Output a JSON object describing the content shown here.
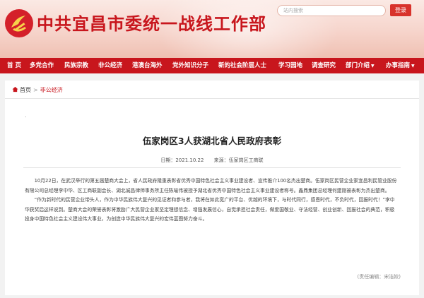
{
  "header": {
    "site_title": "中共宜昌市委统一战线工作部",
    "search_placeholder": "站内搜索",
    "login_label": "登录"
  },
  "colors": {
    "brand_red": "#c8161d",
    "login_red": "#d8322b"
  },
  "nav": {
    "items": [
      {
        "label": "首 页",
        "caret": ""
      },
      {
        "label": "多党合作",
        "caret": ""
      },
      {
        "label": "民族宗教",
        "caret": ""
      },
      {
        "label": "非公经济",
        "caret": ""
      },
      {
        "label": "港澳台海外",
        "caret": ""
      },
      {
        "label": "党外知识分子",
        "caret": ""
      },
      {
        "label": "新的社会阶层人士",
        "caret": ""
      },
      {
        "label": "学习园地",
        "caret": ""
      },
      {
        "label": "调查研究",
        "caret": ""
      },
      {
        "label": "部门介绍",
        "caret": "▼"
      },
      {
        "label": "办事指南",
        "caret": "▼"
      }
    ]
  },
  "breadcrumb": {
    "home": "首页",
    "sep": ">",
    "category": "非公经济"
  },
  "article": {
    "dot": ".",
    "title": "伍家岗区3人获湖北省人民政府表彰",
    "date": "日期：2021.10.22",
    "source": "来源：伍家岗区工商联",
    "paragraphs": [
      "10月22日，在武汉举行的第五届楚商大会上，省人民政府隆重表彰省优秀中国特色社会主义事业建设者、宣传推介100名杰出楚商。伍家岗区民营企业家宜昌利民管业股份有限公司总经理李中华、区工商联副会长、湖北诚昌律师事务所主任陈喻伟被授予湖北省优秀中国特色社会主义事业建设者称号。鑫鼎集团总经理何建刚被表彰为杰出楚商。",
      "“作为新时代的民营企业带头人，作为中华民族伟大复兴的见证者和参与者，我将在如此宽广的平台、优越的环境下，与时代同行，感恩时代，不负时代，回报时代！”李中华获奖后这样说到。楚商大会的荣誉表彰将激励广大民营企业家坚定理想信念、增强发展信心，自觉承担社会责任，做爱国敬业、守法经营、创业创新、回报社会的典范，积极投身中国特色社会主义建设伟大事业，为创造中华民族伟大复兴的宏伟蓝图努力奋斗。"
    ],
    "editor": "(责任编辑：宋洁姣)"
  }
}
